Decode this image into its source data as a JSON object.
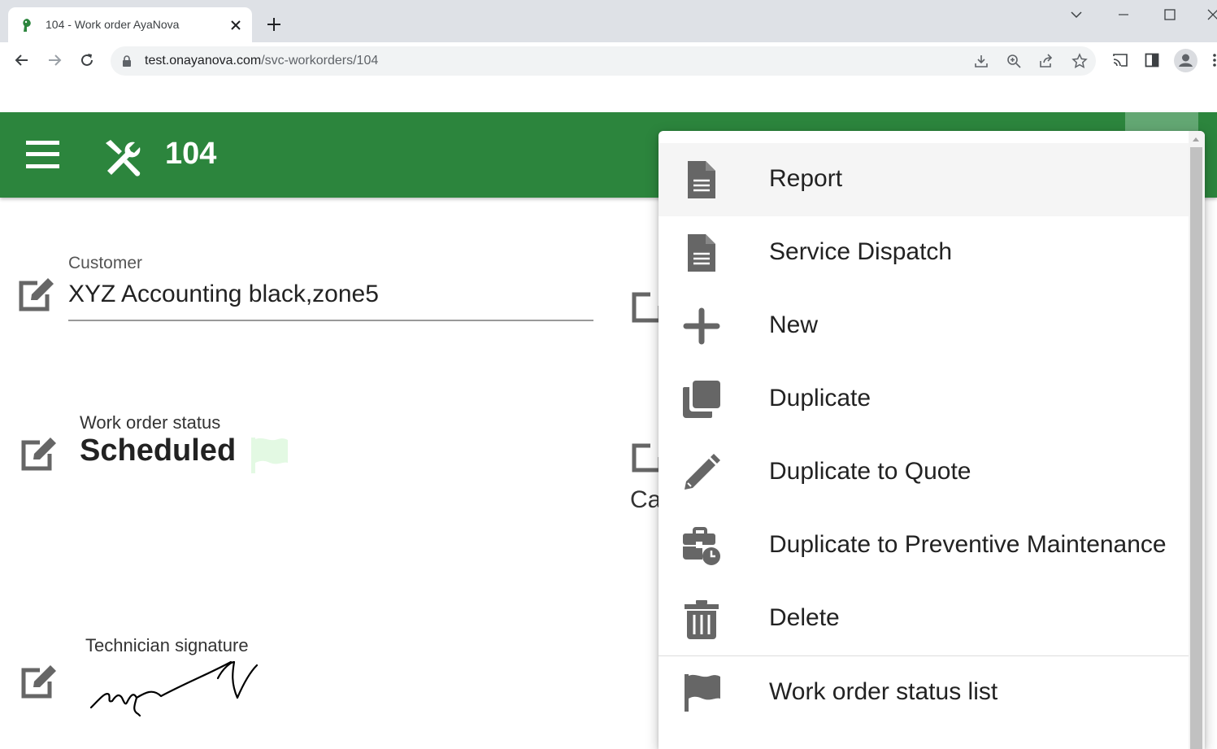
{
  "browser": {
    "tab_title": "104 - Work order AyaNova",
    "url_host": "test.onayanova.com",
    "url_path": "/svc-workorders/104"
  },
  "appbar": {
    "title": "104"
  },
  "form": {
    "customer_label": "Customer",
    "customer_value": "XYZ Accounting black,zone5",
    "status_label": "Work order status",
    "status_value": "Scheduled",
    "signature_label": "Technician signature",
    "partial_label": "Ca"
  },
  "menu": {
    "items": [
      {
        "label": "Report",
        "icon": "report-icon"
      },
      {
        "label": "Service Dispatch",
        "icon": "document-icon"
      },
      {
        "label": "New",
        "icon": "plus-icon"
      },
      {
        "label": "Duplicate",
        "icon": "copy-icon"
      },
      {
        "label": "Duplicate to Quote",
        "icon": "pencil-icon"
      },
      {
        "label": "Duplicate to Preventive Maintenance",
        "icon": "business-time-icon"
      },
      {
        "label": "Delete",
        "icon": "trash-icon"
      },
      {
        "label": "Work order status list",
        "icon": "flag-icon"
      }
    ]
  },
  "colors": {
    "appbar": "#2c853d",
    "icon_gray": "#666666",
    "status_flag": "#e3f9e3"
  }
}
